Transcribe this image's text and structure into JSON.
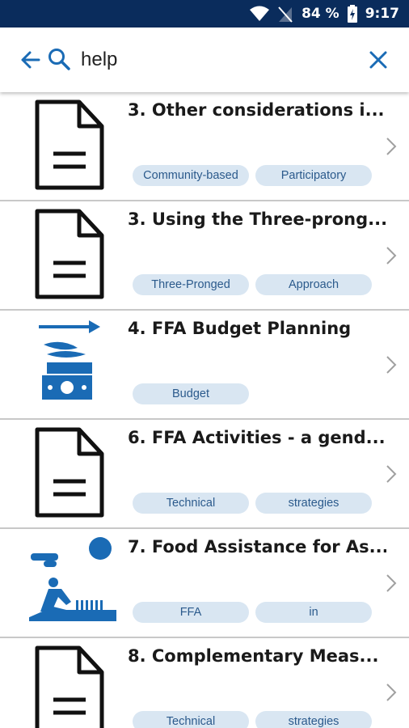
{
  "status_bar": {
    "battery": "84 %",
    "time": "9:17"
  },
  "search": {
    "query": "help"
  },
  "results": [
    {
      "title": "3. Other considerations i...",
      "icon": "document-icon",
      "tags": [
        "Community-based",
        "Participatory"
      ]
    },
    {
      "title": "3. Using the Three-prong...",
      "icon": "document-icon",
      "tags": [
        "Three-Pronged",
        "Approach"
      ]
    },
    {
      "title": "4. FFA Budget Planning",
      "icon": "budget-icon",
      "tags": [
        "Budget"
      ]
    },
    {
      "title": "6. FFA Activities - a gend...",
      "icon": "document-icon",
      "tags": [
        "Technical",
        "strategies"
      ]
    },
    {
      "title": "7. Food Assistance for As...",
      "icon": "farming-icon",
      "tags": [
        "FFA",
        "in"
      ]
    },
    {
      "title": "8. Complementary Meas...",
      "icon": "document-icon",
      "tags": [
        "Technical",
        "strategies"
      ]
    }
  ],
  "colors": {
    "status_bar": "#0a2c5c",
    "accent": "#1a6bb5",
    "tag_bg": "#d9e6f2",
    "tag_text": "#2b5a8c"
  }
}
